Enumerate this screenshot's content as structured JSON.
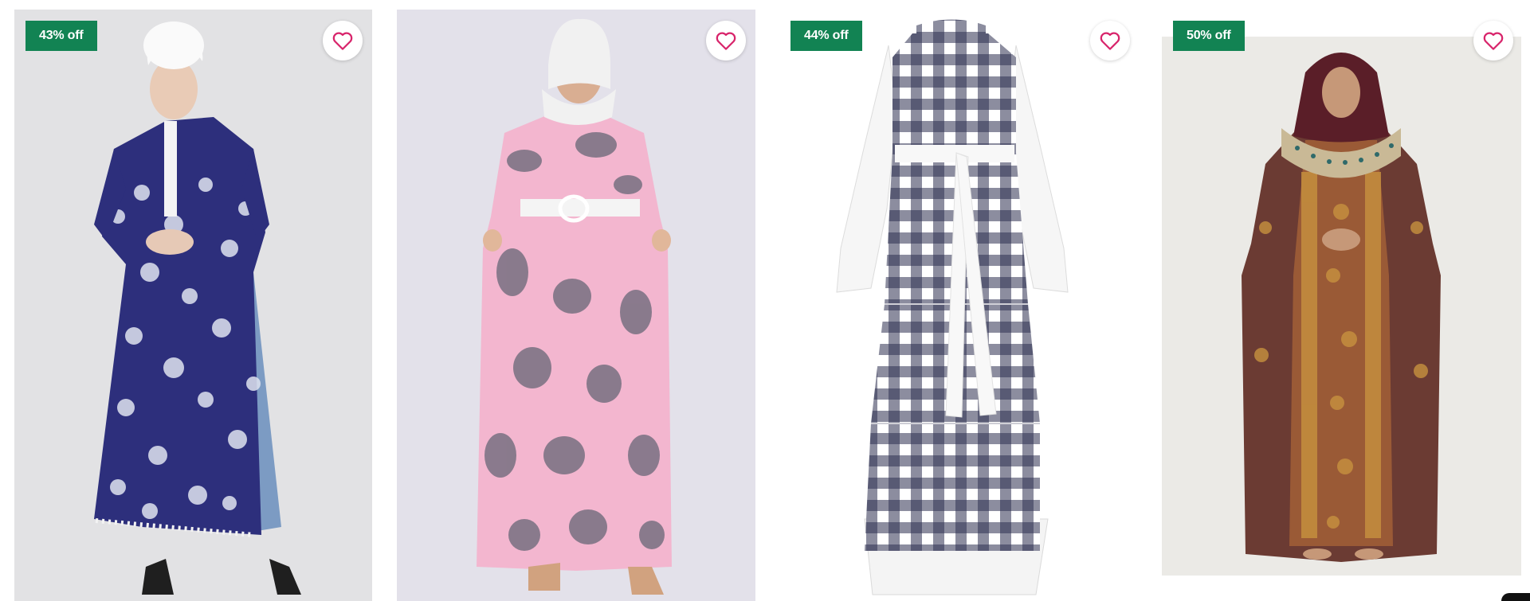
{
  "product_grid": {
    "products": [
      {
        "discount": "43% off",
        "icon": "heart-outline-icon",
        "image": "navy white floral print long kurta with pompom trim and jeans, white turban"
      },
      {
        "discount": "",
        "icon": "heart-outline-icon",
        "image": "pink floral chiffon maxi dress with white belt, white hijab"
      },
      {
        "discount": "44% off",
        "icon": "heart-outline-icon",
        "image": "navy white gingham tiered maxi dress with white sleeves and tie belt"
      },
      {
        "discount": "50% off",
        "icon": "heart-outline-icon",
        "image": "brown printed embellished abaya with maroon hijab"
      }
    ]
  },
  "colors": {
    "badge_bg": "#128353",
    "badge_text": "#ffffff",
    "heart": "#d8246b"
  }
}
